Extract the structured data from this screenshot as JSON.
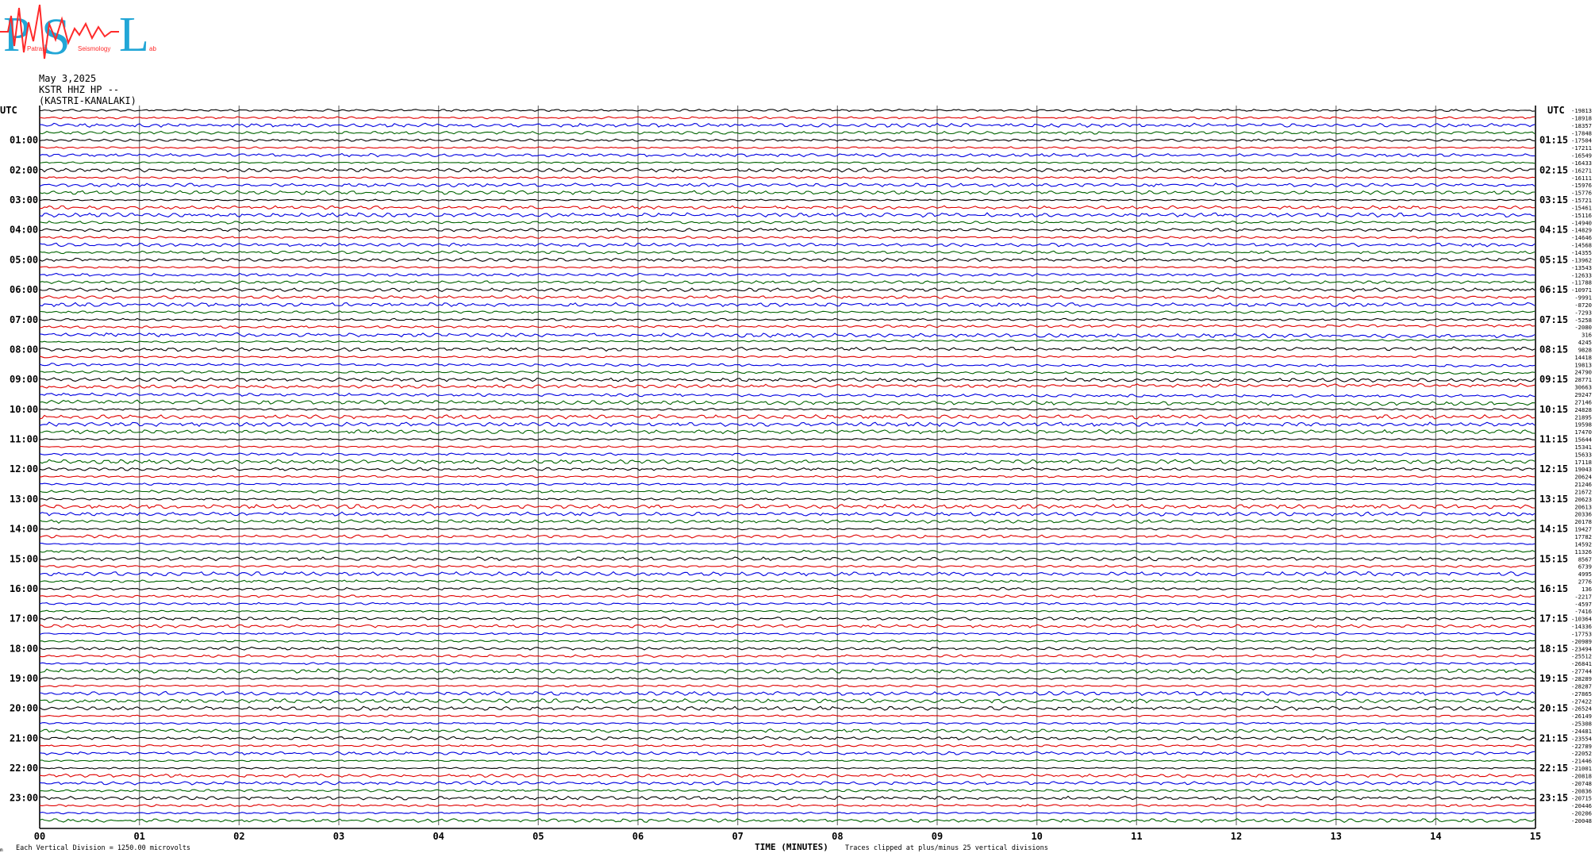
{
  "logo": {
    "letters": "PSL",
    "text_small_1": "Patras",
    "text_small_2": "Seismology",
    "text_small_3": "ab",
    "colors": {
      "main": "#22a6d6",
      "wave": "#ff2a2a"
    }
  },
  "header": {
    "date": "May 3,2025",
    "station": "KSTR HHZ HP --",
    "location": "(KASTRI-KANALAKI)"
  },
  "chart_data": {
    "type": "line",
    "left_axis_title": "UTC",
    "right_axis_title": "UTC",
    "left_hour_labels": [
      "01:00",
      "02:00",
      "03:00",
      "04:00",
      "05:00",
      "06:00",
      "07:00",
      "08:00",
      "09:00",
      "10:00",
      "11:00",
      "12:00",
      "13:00",
      "14:00",
      "15:00",
      "16:00",
      "17:00",
      "18:00",
      "19:00",
      "20:00",
      "21:00",
      "22:00",
      "23:00"
    ],
    "right_hour_labels": [
      "01:15",
      "02:15",
      "03:15",
      "04:15",
      "05:15",
      "06:15",
      "07:15",
      "08:15",
      "09:15",
      "10:15",
      "11:15",
      "12:15",
      "13:15",
      "14:15",
      "15:15",
      "16:15",
      "17:15",
      "18:15",
      "19:15",
      "20:15",
      "21:15",
      "22:15",
      "23:15"
    ],
    "trace_offsets": [
      "-19813",
      "-18918",
      "-18357",
      "-17848",
      "-17504",
      "-17211",
      "-16549",
      "-16433",
      "-16271",
      "-16111",
      "-15976",
      "-15776",
      "-15721",
      "-15461",
      "-15116",
      "-14940",
      "-14829",
      "-14646",
      "-14568",
      "-14355",
      "-13962",
      "-13543",
      "-12633",
      "-11788",
      "-10971",
      "-9991",
      "-8720",
      "-7293",
      "-5258",
      "-2080",
      "316",
      "4245",
      "9828",
      "14418",
      "19813",
      "24790",
      "28771",
      "30663",
      "29247",
      "27146",
      "24828",
      "21895",
      "19598",
      "17470",
      "15644",
      "15341",
      "15633",
      "17118",
      "19043",
      "20624",
      "21246",
      "21672",
      "20623",
      "20613",
      "20336",
      "20178",
      "19427",
      "17782",
      "14592",
      "11326",
      "8567",
      "6739",
      "4995",
      "2776",
      "136",
      "-2217",
      "-4597",
      "-7416",
      "-10364",
      "-14336",
      "-17753",
      "-20989",
      "-23494",
      "-25512",
      "-26841",
      "-27744",
      "-28289",
      "-28287",
      "-27865",
      "-27422",
      "-26524",
      "-26149",
      "-25308",
      "-24481",
      "-23554",
      "-22789",
      "-22052",
      "-21446",
      "-21001",
      "-20818",
      "-20748",
      "-20836",
      "-20715",
      "-20446",
      "-20206",
      "-20048"
    ],
    "x_ticks": [
      "00",
      "01",
      "02",
      "03",
      "04",
      "05",
      "06",
      "07",
      "08",
      "09",
      "10",
      "11",
      "12",
      "13",
      "14",
      "15"
    ],
    "xlabel": "TIME (MINUTES)",
    "xlim": [
      0,
      15
    ],
    "footer_left": "Each Vertical Division = 1250.00 microvolts",
    "footer_right": "Traces clipped at plus/minus 25 vertical divisions",
    "corner_mark": "m",
    "series_colors": [
      "#000000",
      "#e00000",
      "#0000e0",
      "#006400"
    ],
    "grid": true
  }
}
